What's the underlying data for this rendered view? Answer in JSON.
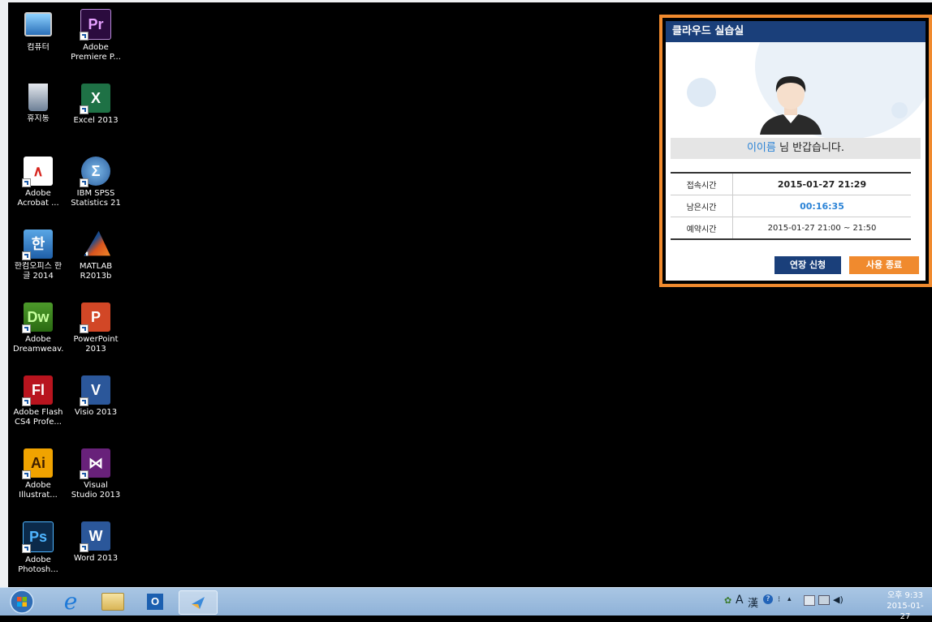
{
  "desktop": {
    "icons": [
      {
        "label": "컴퓨터",
        "icon": "computer-icon"
      },
      {
        "label": "Adobe Premiere P...",
        "icon": "premiere-icon",
        "glyph": "Pr"
      },
      {
        "label": "휴지통",
        "icon": "recycle-bin-icon"
      },
      {
        "label": "Excel 2013",
        "icon": "excel-icon",
        "glyph": "X"
      },
      {
        "label": "Adobe Acrobat ...",
        "icon": "acrobat-icon"
      },
      {
        "label": "IBM SPSS Statistics 21",
        "icon": "spss-icon",
        "glyph": "Σ"
      },
      {
        "label": "한컴오피스 한글 2014",
        "icon": "hangul-icon",
        "glyph": "한"
      },
      {
        "label": "MATLAB R2013b",
        "icon": "matlab-icon"
      },
      {
        "label": "Adobe Dreamweav...",
        "icon": "dreamweaver-icon",
        "glyph": "Dw"
      },
      {
        "label": "PowerPoint 2013",
        "icon": "powerpoint-icon",
        "glyph": "P"
      },
      {
        "label": "Adobe Flash CS4 Profe...",
        "icon": "flash-icon",
        "glyph": "Fl"
      },
      {
        "label": "Visio 2013",
        "icon": "visio-icon",
        "glyph": "V"
      },
      {
        "label": "Adobe Illustrat...",
        "icon": "illustrator-icon",
        "glyph": "Ai"
      },
      {
        "label": "Visual Studio 2013",
        "icon": "visual-studio-icon",
        "glyph": "⋈"
      },
      {
        "label": "Adobe Photosh...",
        "icon": "photoshop-icon",
        "glyph": "Ps"
      },
      {
        "label": "Word 2013",
        "icon": "word-icon",
        "glyph": "W"
      }
    ]
  },
  "popup": {
    "title": "클라우드 실습실",
    "user_name": "이이름",
    "welcome_suffix": " 님 반갑습니다.",
    "rows": [
      {
        "label": "접속시간",
        "value": "2015-01-27 21:29"
      },
      {
        "label": "남은시간",
        "value": "00:16:35"
      },
      {
        "label": "예약시간",
        "value": "2015-01-27 21:00 ~ 21:50"
      }
    ],
    "extend_button": "연장 신청",
    "end_button": "사용 종료",
    "colors": {
      "title_bar": "#1a3f7a",
      "accent_orange": "#f08a2e",
      "highlight_blue": "#2b83d6"
    }
  },
  "taskbar": {
    "items": [
      "start-orb-icon",
      "ie-icon",
      "file-explorer-icon",
      "outlook-icon",
      "app-icon"
    ],
    "tray": {
      "ime_mode": "A",
      "hanja": "漢",
      "time": "오후 9:33",
      "date": "2015-01-27"
    }
  }
}
